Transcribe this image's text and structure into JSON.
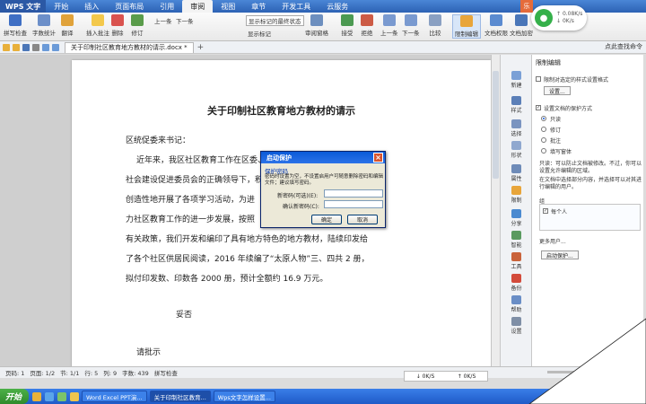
{
  "titlebar": {
    "app_name": "WPS 文字",
    "menus": [
      "开始",
      "插入",
      "页面布局",
      "引用",
      "审阅",
      "视图",
      "章节",
      "开发工具",
      "云服务"
    ],
    "active_menu": "审阅",
    "user_badge": "乐"
  },
  "network": {
    "up": "0.08K/s",
    "down": "0K/s"
  },
  "ribbon": {
    "buttons": [
      "拼写检查",
      "字数统计",
      "翻译",
      "插入批注",
      "删除",
      "修订",
      "审阅窗格",
      "接受",
      "拒绝",
      "上一条",
      "下一条",
      "比较",
      "限制编辑",
      "文档权限",
      "文档加密"
    ],
    "prev_comment": "上一条",
    "next_comment": "下一条",
    "show_markup": "显示标记的最终状态",
    "show_markup_dd": "显示标记"
  },
  "doc_tab": {
    "title": "关于印制社区教育地方教材的请示.docx *",
    "search": "点此查找命令"
  },
  "document": {
    "title": "关于印制社区教育地方教材的请示",
    "lines": [
      "区统促委来书记：",
      "近年来，我区社区教育工作在区委、区政府",
      "社会建设促进委员会的正确领导下，积",
      "创造性地开展了各项学习活动，为进",
      "力社区教育工作的进一步发展，按照",
      "有关政策，我们开发和编印了具有地方特色的地方教材，陆续印发给",
      "了各个社区供居民阅读，2016 年续编了“太原人物”三、四共 2 册，",
      "拟付印发数、印数各 2000 册，预计全额约 16.9 万元。",
      "妥否",
      "请批示"
    ]
  },
  "dialog": {
    "title": "启动保护",
    "section": "保护密码",
    "desc": "密码时设置为空，不设置启用户可随意删除密码和编辑文件；建议填写密码。",
    "new_password_label": "新密码(可选)(E):",
    "confirm_password_label": "确认新密码(C):",
    "ok": "确定",
    "cancel": "取消"
  },
  "sidepanel": {
    "items": [
      "新建",
      "样式",
      "选择",
      "形状",
      "属性",
      "限制",
      "分享",
      "智能",
      "工具",
      "备份",
      "帮助",
      "设置"
    ]
  },
  "protect": {
    "title": "限制编辑",
    "format_limit": "限制对选定的样式设置格式",
    "settings_btn": "设置...",
    "editing_limit": "设置文档的保护方式",
    "options": [
      "只读",
      "修订",
      "批注",
      "填写窗体"
    ],
    "selected_option": "只读",
    "note": "只读：可以防止文档被修改。不过，你可以设置允许编辑的区域。",
    "note2": "在文档中选择部分内容，并选择可以对其进行编辑的用户。",
    "group_label": "组",
    "everyone": "每个人",
    "more_users": "更多用户...",
    "start_btn": "启动保护..."
  },
  "statusbar": {
    "items": [
      "页码: 1",
      "页面: 1/2",
      "节: 1/1",
      "行: 5",
      "列: 9",
      "字数: 439",
      "拼写检查"
    ]
  },
  "speed": {
    "down": "0K/S",
    "up": "0K/S"
  },
  "taskbar": {
    "start": "开始",
    "tasks": [
      "Word Excel PPT演...",
      "关于印制社区教育...",
      "Wps文字怎样设置..."
    ],
    "active_task": 1
  }
}
